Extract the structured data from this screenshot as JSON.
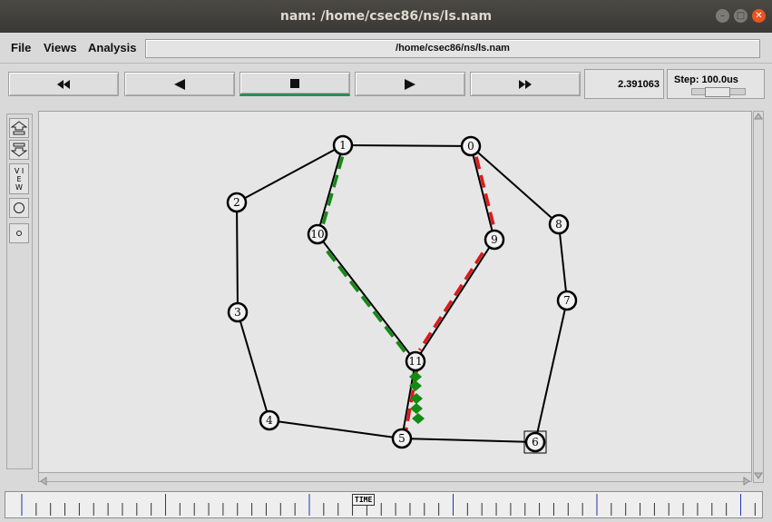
{
  "window": {
    "title": "nam: /home/csec86/ns/ls.nam",
    "controls": [
      "minimize",
      "maximize",
      "close"
    ]
  },
  "menu": {
    "file": "File",
    "views": "Views",
    "analysis": "Analysis"
  },
  "file_path": "/home/csec86/ns/ls.nam",
  "playback": {
    "rewind_icon": "fast-rewind-icon",
    "back_icon": "play-backward-icon",
    "stop_icon": "stop-icon",
    "play_icon": "play-forward-icon",
    "ff_icon": "fast-forward-icon",
    "active": "stop"
  },
  "time": "2.391063",
  "step": "Step: 100.0us",
  "view_tools": {
    "view_label": "V I E W",
    "zoom_in_icon": "zoom-in-icon",
    "zoom_out_icon": "zoom-out-icon"
  },
  "timeline": {
    "label": "TIME"
  },
  "colors": {
    "flow_green": "#138a13",
    "flow_red": "#e01818",
    "accent_bar": "#2e8b57",
    "titlebar": "#3d3c38",
    "close_button": "#e95420"
  },
  "network": {
    "nodes": [
      {
        "id": "0",
        "label": "0"
      },
      {
        "id": "1",
        "label": "1"
      },
      {
        "id": "2",
        "label": "2"
      },
      {
        "id": "3",
        "label": "3"
      },
      {
        "id": "4",
        "label": "4"
      },
      {
        "id": "5",
        "label": "5"
      },
      {
        "id": "6",
        "label": "6"
      },
      {
        "id": "7",
        "label": "7"
      },
      {
        "id": "8",
        "label": "8"
      },
      {
        "id": "9",
        "label": "9"
      },
      {
        "id": "10",
        "label": "10"
      },
      {
        "id": "11",
        "label": "11"
      }
    ],
    "links": [
      [
        "1",
        "0"
      ],
      [
        "1",
        "2"
      ],
      [
        "2",
        "3"
      ],
      [
        "3",
        "4"
      ],
      [
        "4",
        "5"
      ],
      [
        "5",
        "6"
      ],
      [
        "6",
        "7"
      ],
      [
        "7",
        "8"
      ],
      [
        "8",
        "0"
      ],
      [
        "0",
        "9"
      ],
      [
        "9",
        "11"
      ],
      [
        "1",
        "10"
      ],
      [
        "10",
        "11"
      ],
      [
        "11",
        "5"
      ]
    ],
    "selected_node": "6"
  }
}
